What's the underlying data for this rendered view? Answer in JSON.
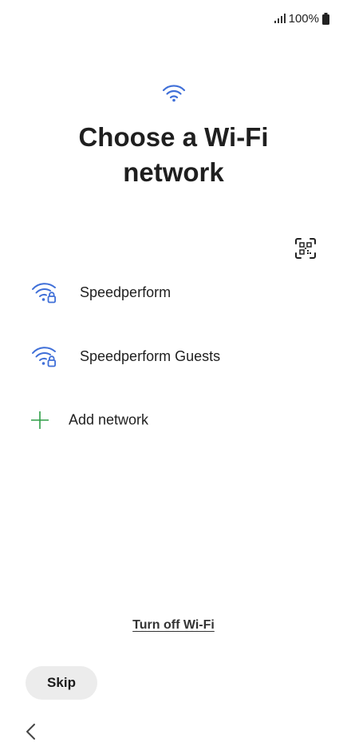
{
  "status_bar": {
    "battery_text": "100%",
    "signal_icon": "signal-bars-icon",
    "battery_icon": "battery-full-icon"
  },
  "header": {
    "icon": "wifi-icon",
    "title": "Choose a Wi-Fi network"
  },
  "qr_scan": {
    "icon": "qr-scan-icon"
  },
  "networks": [
    {
      "name": "Speedperform",
      "icon": "wifi-locked-icon"
    },
    {
      "name": "Speedperform Guests",
      "icon": "wifi-locked-icon"
    }
  ],
  "add_network": {
    "label": "Add network",
    "icon": "plus-icon"
  },
  "footer": {
    "turn_off_label": "Turn off Wi-Fi",
    "skip_label": "Skip",
    "back_icon": "chevron-left-icon"
  },
  "colors": {
    "wifi_blue": "#3f6fd8",
    "add_green": "#2e9e47",
    "skip_bg": "#ececec"
  }
}
